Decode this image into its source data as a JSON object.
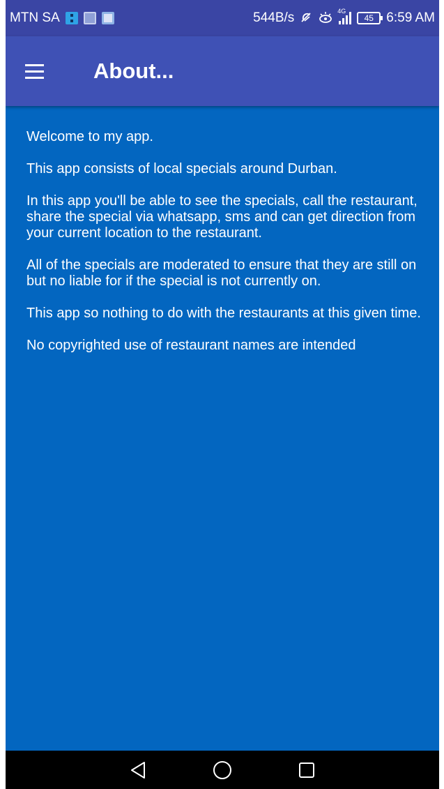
{
  "status_bar": {
    "carrier": "MTN SA",
    "speed": "544B/s",
    "network": "4G",
    "battery": "45",
    "time": "6:59 AM"
  },
  "toolbar": {
    "title": "About..."
  },
  "about": {
    "paragraphs": [
      "Welcome to my app.",
      "This app consists of local specials around Durban.",
      "In this app you'll be able to see the specials, call the restaurant, share the special via whatsapp, sms and can get direction from your current location to the restaurant.",
      "All of the specials are moderated to ensure that they are still on but no liable for if the special is not currently on.",
      "This app so nothing to do with the restaurants at this given time.",
      "No copyrighted use of restaurant names are intended"
    ]
  },
  "colors": {
    "status_bar": "#3a45a4",
    "toolbar": "#3f51b5",
    "content_bg": "#0366c0",
    "nav_bar": "#000000"
  },
  "icons": {
    "menu": "hamburger-menu-icon",
    "back": "back-triangle-icon",
    "home": "home-circle-icon",
    "recents": "recents-square-icon"
  }
}
